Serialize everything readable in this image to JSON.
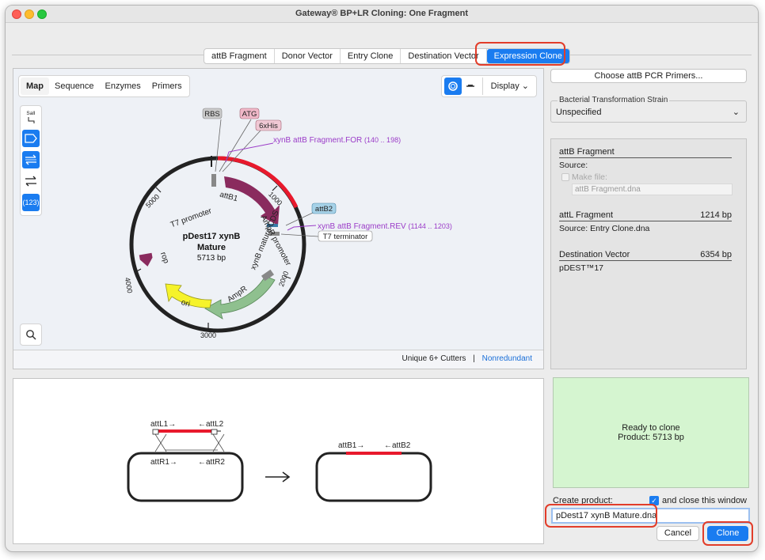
{
  "window": {
    "title": "Gateway® BP+LR Cloning: One Fragment"
  },
  "tabs": [
    "attB Fragment",
    "Donor Vector",
    "Entry Clone",
    "Destination Vector",
    "Expression Clone"
  ],
  "active_tab": "Expression Clone",
  "map_view": {
    "subtabs": [
      "Map",
      "Sequence",
      "Enzymes",
      "Primers"
    ],
    "active_subtab": "Map",
    "display_label": "Display",
    "tools": {
      "sali_label": "SalI",
      "count_label": "(123)"
    },
    "footer": {
      "cutters": "Unique 6+ Cutters",
      "separator": "|",
      "redundancy": "Nonredundant"
    },
    "plasmid": {
      "name_line1": "pDest17 xynB",
      "name_line2": "Mature",
      "size": "5713 bp",
      "ticks": [
        "1000",
        "2000",
        "3000",
        "4000",
        "5000"
      ],
      "features": {
        "rbs": "RBS",
        "atg": "ATG",
        "his": "6xHis",
        "attb1": "attB1",
        "attb2": "attB2",
        "t7_promoter": "T7 promoter",
        "t7_terminator": "T7 terminator",
        "ampr_promoter": "AmpR promoter",
        "xynb_cds": "xynB mature CDS",
        "ampr": "AmpR",
        "ori": "ori",
        "rop": "rop"
      },
      "primers": {
        "for_name": "xynB attB Fragment.FOR",
        "for_range": "(140 .. 198)",
        "rev_name": "xynB attB Fragment.REV",
        "rev_range": "(1144 .. 1203)"
      }
    }
  },
  "sidebar": {
    "primer_button": "Choose attB PCR Primers...",
    "strain_legend": "Bacterial Transformation Strain",
    "strain_value": "Unspecified",
    "info": {
      "attb_title": "attB Fragment",
      "attb_source_label": "Source:",
      "make_file_label": "Make file:",
      "make_file_value": "attB Fragment.dna",
      "attl_title": "attL Fragment",
      "attl_size": "1214 bp",
      "attl_source": "Source:  Entry Clone.dna",
      "dest_title": "Destination Vector",
      "dest_size": "6354 bp",
      "dest_name": "pDEST™17"
    }
  },
  "diagram": {
    "attl1": "attL1→",
    "attl2": "←attL2",
    "attr1": "attR1→",
    "attr2": "←attR2",
    "attb1": "attB1→",
    "attb2": "←attB2"
  },
  "status": {
    "line1": "Ready to clone",
    "line2": "Product:  5713 bp"
  },
  "create": {
    "label": "Create product:",
    "close_label": "and close this window",
    "close_checked": true,
    "product_name": "pDest17 xynB Mature.dna"
  },
  "buttons": {
    "cancel": "Cancel",
    "clone": "Clone"
  },
  "colors": {
    "accent": "#1a7cf0",
    "highlight": "#e23d2a",
    "insert": "#e8192c",
    "ready_bg": "#d5f5d0",
    "feature_purple": "#8a2b5e",
    "ampr_green": "#8fc08f",
    "ori_yellow": "#f6f32a"
  }
}
